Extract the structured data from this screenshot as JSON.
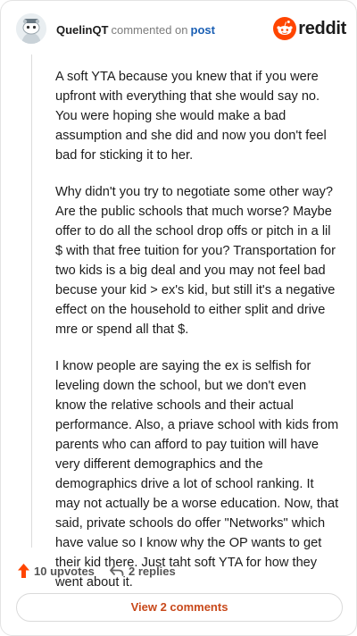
{
  "comment": {
    "username": "QuelinQT",
    "action_text": "commented on",
    "post_link": "post",
    "brand": "reddit",
    "paragraphs": [
      "A soft YTA because you knew that if you were upfront with everything that she would say no. You were hoping she would make a bad assumption and she did and now you don't feel bad for sticking it to her.",
      "Why didn't you try to negotiate some other way? Are the public schools that much worse? Maybe offer to do all the school drop offs or pitch in a lil $ with that free tuition for you? Transportation for two kids is a big deal and you may not feel bad becuse your kid > ex's kid, but still it's a negative effect on the household to either split and drive mre or spend all that $.",
      "I know people are saying the ex is selfish for leveling down the school, but we don't even know the relative schools and their actual performance. Also, a priave school with kids from parents who can afford to pay tuition will have very different demographics and the demographics drive a lot of school ranking. It may not actually be a worse education. Now, that said, private schools do offer \"Networks\" which have value so I know why the OP wants to get their kid there. Just taht soft YTA for how they went about it."
    ],
    "upvotes": "10 upvotes",
    "replies": "2 replies",
    "view_comments": "View 2 comments"
  },
  "colors": {
    "brand_orange": "#ff4500",
    "link_blue": "#1a5fb4",
    "view_button_text": "#c8491b"
  },
  "icons": {
    "avatar": "snoo-avatar",
    "brand": "reddit-alien-icon",
    "upvote": "upvote-arrow-icon",
    "reply": "reply-arrow-icon"
  }
}
